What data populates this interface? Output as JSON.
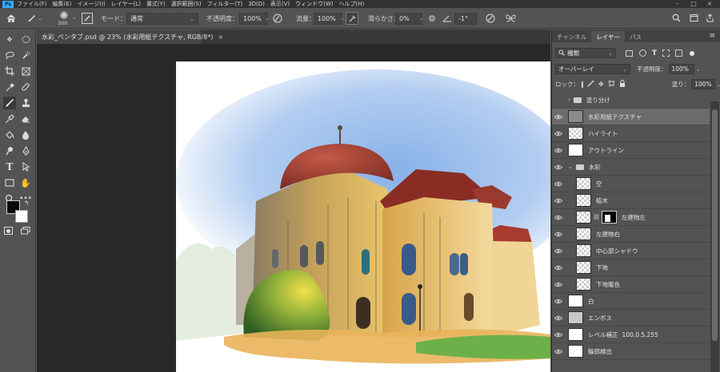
{
  "app": {
    "menu": [
      "ファイル(F)",
      "編集(E)",
      "イメージ(I)",
      "レイヤー(L)",
      "書式(Y)",
      "選択範囲(S)",
      "フィルター(T)",
      "3D(D)",
      "表示(V)",
      "ウィンドウ(W)",
      "ヘルプ(H)"
    ]
  },
  "options_bar": {
    "brush_size": "300",
    "mode_label": "モード：",
    "mode_value": "通常",
    "opacity_label": "不透明度：",
    "opacity_value": "100%",
    "flow_label": "流量：",
    "flow_value": "100%",
    "smoothing_label": "滑らかさ：",
    "smoothing_value": "0%",
    "angle_value": "-1°"
  },
  "document": {
    "tab_title": "水彩_ペンタブ.psd @ 23% (水彩用紙テクスチャ, RGB/8*)",
    "close_glyph": "×"
  },
  "panel": {
    "tabs": [
      "チャンネル",
      "レイヤー",
      "パス"
    ],
    "active_tab": 1,
    "filter_kind": "種類",
    "blend_mode": "オーバーレイ",
    "opacity_label": "不透明度：",
    "opacity_value": "100%",
    "lock_label": "ロック：",
    "fill_label": "塗り：",
    "fill_value": "100%"
  },
  "layers": [
    {
      "name": "塗り分け",
      "type": "group",
      "visible": false,
      "collapsed": true
    },
    {
      "name": "水彩用紙テクスチャ",
      "type": "pixel",
      "thumb": "gray",
      "visible": true,
      "selected": true
    },
    {
      "name": "ハイライト",
      "type": "pixel",
      "thumb": "checker",
      "visible": true
    },
    {
      "name": "アウトライン",
      "type": "pixel",
      "thumb": "white",
      "visible": true
    },
    {
      "name": "水彩",
      "type": "group",
      "visible": true,
      "collapsed": false
    },
    {
      "name": "空",
      "type": "pixel",
      "thumb": "checker",
      "visible": true,
      "indent": true
    },
    {
      "name": "植木",
      "type": "pixel",
      "thumb": "checker",
      "visible": true,
      "indent": true
    },
    {
      "name": "左建物左",
      "type": "masked",
      "thumb": "checker",
      "visible": true,
      "indent": true
    },
    {
      "name": "左建物右",
      "type": "pixel",
      "thumb": "checker",
      "visible": true,
      "indent": true
    },
    {
      "name": "中心部シャドウ",
      "type": "pixel",
      "thumb": "checker",
      "visible": true,
      "indent": true
    },
    {
      "name": "下地",
      "type": "pixel",
      "thumb": "checker",
      "visible": true,
      "indent": true
    },
    {
      "name": "下地暖色",
      "type": "pixel",
      "thumb": "checker",
      "visible": true,
      "indent": true
    },
    {
      "name": "白",
      "type": "pixel",
      "thumb": "white",
      "visible": true
    },
    {
      "name": "エンボス",
      "type": "pixel",
      "thumb": "light",
      "visible": true
    },
    {
      "name": "レベル補正",
      "extra": "100,0.5,255",
      "type": "pixel",
      "thumb": "white",
      "visible": true
    },
    {
      "name": "輪郭検出",
      "type": "pixel",
      "thumb": "white",
      "visible": true
    }
  ],
  "colors": {
    "ui_bg": "#535353",
    "panel_dark": "#424242",
    "canvas_bg": "#282828",
    "selected_layer": "#6b6b6b",
    "accent": "#31a8ff"
  }
}
